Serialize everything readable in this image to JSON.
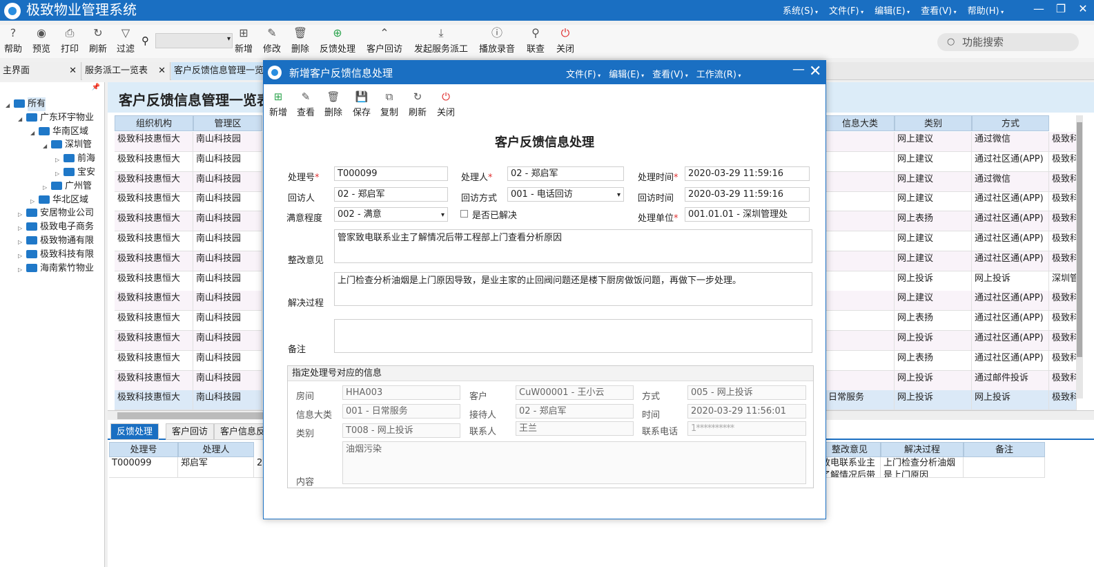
{
  "app": {
    "title": "极致物业管理系统",
    "menus": [
      "系统(S)",
      "文件(F)",
      "编辑(E)",
      "查看(V)",
      "帮助(H)"
    ],
    "window_buttons": [
      "—",
      "❐",
      "✕"
    ]
  },
  "toolbar": {
    "buttons": [
      {
        "label": "帮助",
        "icon": "help-icon",
        "glyph": "?"
      },
      {
        "label": "预览",
        "icon": "eye-icon",
        "glyph": "◉"
      },
      {
        "label": "打印",
        "icon": "printer-icon",
        "glyph": "⎙"
      },
      {
        "label": "刷新",
        "icon": "refresh-icon",
        "glyph": "↻"
      },
      {
        "label": "过滤",
        "icon": "filter-icon",
        "glyph": "▽"
      },
      {
        "label": "新增",
        "icon": "add-icon",
        "glyph": "⊞"
      },
      {
        "label": "修改",
        "icon": "edit-icon",
        "glyph": "✎"
      },
      {
        "label": "删除",
        "icon": "delete-icon",
        "glyph": "🗑"
      },
      {
        "label": "反馈处理",
        "icon": "plus-circle-icon",
        "glyph": "⊕"
      },
      {
        "label": "客户回访",
        "icon": "caret-up-icon",
        "glyph": "⌃"
      },
      {
        "label": "发起服务派工",
        "icon": "download-icon",
        "glyph": "⤓"
      },
      {
        "label": "播放录音",
        "icon": "info-icon",
        "glyph": "ⓘ"
      },
      {
        "label": "联查",
        "icon": "search-icon",
        "glyph": "⚲"
      },
      {
        "label": "关闭",
        "icon": "power-icon",
        "glyph": "⏻"
      }
    ],
    "search_placeholder": "",
    "function_search": "功能搜索"
  },
  "tabs": [
    {
      "label": "主界面",
      "close": "✕"
    },
    {
      "label": "服务派工一览表",
      "close": "✕"
    },
    {
      "label": "客户反馈信息管理一览",
      "close": ""
    }
  ],
  "tree": [
    {
      "label": "所有",
      "level": 0,
      "arrow": "◢",
      "selected": true
    },
    {
      "label": "广东环宇物业",
      "level": 1,
      "arrow": "◢"
    },
    {
      "label": "华南区域",
      "level": 2,
      "arrow": "◢"
    },
    {
      "label": "深圳管",
      "level": 3,
      "arrow": "◢"
    },
    {
      "label": "前海",
      "level": 4,
      "arrow": "▷"
    },
    {
      "label": "宝安",
      "level": 4,
      "arrow": "▷"
    },
    {
      "label": "广州管",
      "level": 3,
      "arrow": "▷"
    },
    {
      "label": "华北区域",
      "level": 2,
      "arrow": "▷"
    },
    {
      "label": "安居物业公司",
      "level": 1,
      "arrow": "▷"
    },
    {
      "label": "极致电子商务",
      "level": 1,
      "arrow": "▷"
    },
    {
      "label": "极致物通有限",
      "level": 1,
      "arrow": "▷"
    },
    {
      "label": "极致科技有限",
      "level": 1,
      "arrow": "▷"
    },
    {
      "label": "海南紫竹物业",
      "level": 1,
      "arrow": "▷"
    }
  ],
  "main": {
    "title": "客户反馈信息管理一览表",
    "left_headers": [
      "组织机构",
      "管理区"
    ],
    "right_headers": [
      "信息大类",
      "类别",
      "方式"
    ],
    "rows": [
      {
        "org": "极致科技惠恒大",
        "area": "南山科技园",
        "cat": "",
        "type": "网上建议",
        "way": "通过微信",
        "extra": "极致科"
      },
      {
        "org": "极致科技惠恒大",
        "area": "南山科技园",
        "cat": "",
        "type": "网上建议",
        "way": "通过社区通(APP)",
        "extra": "极致科"
      },
      {
        "org": "极致科技惠恒大",
        "area": "南山科技园",
        "cat": "",
        "type": "网上建议",
        "way": "通过微信",
        "extra": "极致科"
      },
      {
        "org": "极致科技惠恒大",
        "area": "南山科技园",
        "cat": "",
        "type": "网上建议",
        "way": "通过社区通(APP)",
        "extra": "极致科"
      },
      {
        "org": "极致科技惠恒大",
        "area": "南山科技园",
        "cat": "",
        "type": "网上表扬",
        "way": "通过社区通(APP)",
        "extra": "极致科"
      },
      {
        "org": "极致科技惠恒大",
        "area": "南山科技园",
        "cat": "",
        "type": "网上建议",
        "way": "通过社区通(APP)",
        "extra": "极致科"
      },
      {
        "org": "极致科技惠恒大",
        "area": "南山科技园",
        "cat": "",
        "type": "网上建议",
        "way": "通过社区通(APP)",
        "extra": "极致科"
      },
      {
        "org": "极致科技惠恒大",
        "area": "南山科技园",
        "cat": "",
        "type": "网上投诉",
        "way": "网上投诉",
        "extra": "深圳管"
      },
      {
        "org": "极致科技惠恒大",
        "area": "南山科技园",
        "cat": "",
        "type": "网上建议",
        "way": "通过社区通(APP)",
        "extra": "极致科"
      },
      {
        "org": "极致科技惠恒大",
        "area": "南山科技园",
        "cat": "",
        "type": "网上表扬",
        "way": "通过社区通(APP)",
        "extra": "极致科"
      },
      {
        "org": "极致科技惠恒大",
        "area": "南山科技园",
        "cat": "",
        "type": "网上投诉",
        "way": "通过社区通(APP)",
        "extra": "极致科"
      },
      {
        "org": "极致科技惠恒大",
        "area": "南山科技园",
        "cat": "",
        "type": "网上表扬",
        "way": "通过社区通(APP)",
        "extra": "极致科"
      },
      {
        "org": "极致科技惠恒大",
        "area": "南山科技园",
        "cat": "",
        "type": "网上投诉",
        "way": "通过邮件投诉",
        "extra": "极致科"
      },
      {
        "org": "极致科技惠恒大",
        "area": "南山科技园",
        "cat": "日常服务",
        "type": "网上投诉",
        "way": "网上投诉",
        "extra": "极致科"
      }
    ],
    "subtabs": [
      "反馈处理",
      "客户回访",
      "客户信息反"
    ],
    "sub_headers_left": [
      "处理号",
      "处理人"
    ],
    "sub_headers_right": [
      "整改意见",
      "解决过程",
      "备注"
    ],
    "sub_row": {
      "no": "T000099",
      "person": "郑启军",
      "mid": "2",
      "opinion": "致电联系业主了解情况后带工",
      "process": "上门检查分析油烟是上门原因",
      "note": ""
    }
  },
  "dialog": {
    "title": "新增客户反馈信息处理",
    "menus": [
      "文件(F)",
      "编辑(E)",
      "查看(V)",
      "工作流(R)"
    ],
    "min": "—",
    "close": "✕",
    "toolbar": [
      {
        "label": "新增",
        "icon": "add-icon",
        "glyph": "⊞"
      },
      {
        "label": "查看",
        "icon": "edit-icon",
        "glyph": "✎"
      },
      {
        "label": "删除",
        "icon": "delete-icon",
        "glyph": "🗑"
      },
      {
        "label": "保存",
        "icon": "save-icon",
        "glyph": "💾"
      },
      {
        "label": "复制",
        "icon": "copy-icon",
        "glyph": "⧉"
      },
      {
        "label": "刷新",
        "icon": "refresh-icon",
        "glyph": "↻"
      },
      {
        "label": "关闭",
        "icon": "power-icon",
        "glyph": "⏻"
      }
    ],
    "form_title": "客户反馈信息处理",
    "fields": {
      "no_label": "处理号",
      "no_value": "T000099",
      "handler_label": "处理人",
      "handler_value": "02 - 郑启军",
      "time_label": "处理时间",
      "time_value": "2020-03-29 11:59:16",
      "visitor_label": "回访人",
      "visitor_value": "02 - 郑启军",
      "visit_way_label": "回访方式",
      "visit_way_value": "001 - 电话回访",
      "visit_time_label": "回访时间",
      "visit_time_value": "2020-03-29 11:59:16",
      "satisfaction_label": "满意程度",
      "satisfaction_value": "002 - 满意",
      "resolved_label": "是否已解决",
      "unit_label": "处理单位",
      "unit_value": "001.01.01 - 深圳管理处",
      "rectify_label": "整改意见",
      "rectify_value": "管家致电联系业主了解情况后带工程部上门查看分析原因",
      "process_label": "解决过程",
      "process_value": "上门检查分析油烟是上门原因导致，是业主家的止回阀问题还是楼下厨房做饭问题，再做下一步处理。",
      "note_label": "备注",
      "note_value": ""
    },
    "info": {
      "legend": "指定处理号对应的信息",
      "room_label": "房间",
      "room_value": "HHA003",
      "customer_label": "客户",
      "customer_value": "CuW00001 - 王小云",
      "way_label": "方式",
      "way_value": "005 - 网上投诉",
      "category_label": "信息大类",
      "category_value": "001 - 日常服务",
      "receiver_label": "接待人",
      "receiver_value": "02 - 郑启军",
      "time_label": "时间",
      "time_value": "2020-03-29 11:56:01",
      "type_label": "类别",
      "type_value": "T008 - 网上投诉",
      "contact_label": "联系人",
      "contact_value": "王兰",
      "phone_label": "联系电话",
      "phone_value": "1**********",
      "content_label": "内容",
      "content_value": "油烟污染"
    }
  },
  "colors": {
    "brand": "#1a6fc2",
    "header_row": "#cce0f3",
    "required": "#e03030"
  }
}
